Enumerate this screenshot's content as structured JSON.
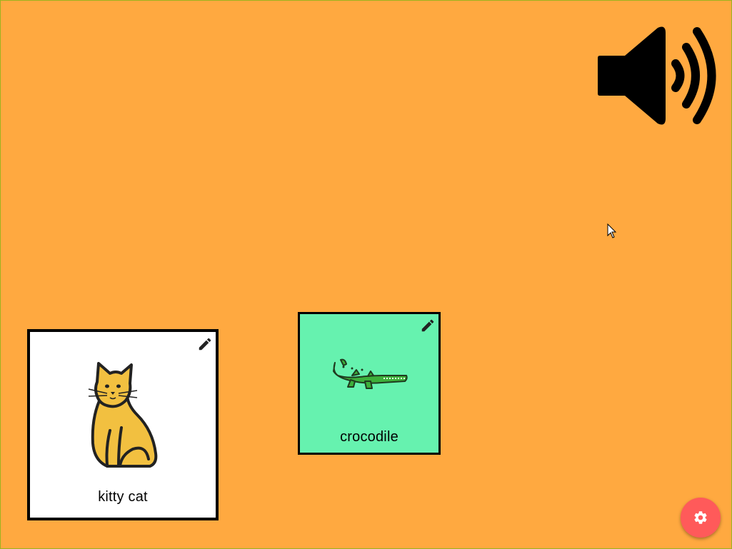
{
  "colors": {
    "background": "#FFA940",
    "cat_card_bg": "#FFFFFF",
    "croc_card_bg": "#66F2AF",
    "fab_bg": "#FF5A5A",
    "fab_icon": "#FFFFFF"
  },
  "icons": {
    "speaker": "speaker-volume-icon",
    "edit": "pencil-icon",
    "settings": "gear-icon"
  },
  "cards": {
    "cat": {
      "label": "kitty cat",
      "image": "cat-picture"
    },
    "croc": {
      "label": "crocodile",
      "image": "crocodile-picture"
    }
  }
}
